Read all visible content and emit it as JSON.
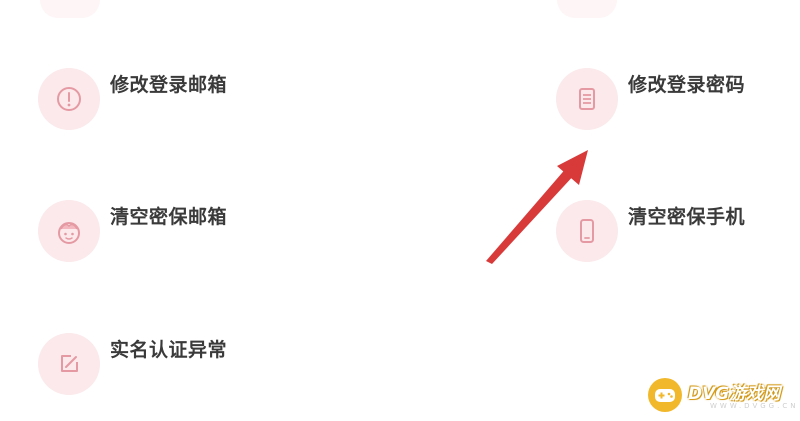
{
  "options": [
    {
      "label": "修改登录邮箱",
      "icon": "info-circle-icon"
    },
    {
      "label": "修改登录密码",
      "icon": "document-list-icon"
    },
    {
      "label": "清空密保邮箱",
      "icon": "face-icon"
    },
    {
      "label": "清空密保手机",
      "icon": "mobile-phone-icon"
    },
    {
      "label": "实名认证异常",
      "icon": "edit-square-icon"
    }
  ],
  "colors": {
    "icon_bg": "#fbe9eb",
    "icon_stroke": "#e59aa3",
    "label_text": "#3a3a3a",
    "arrow": "#d83a3a"
  },
  "watermark": {
    "name": "DVG游戏网",
    "domain": "WWW.DVGG.CN",
    "icon": "gamepad-icon"
  }
}
